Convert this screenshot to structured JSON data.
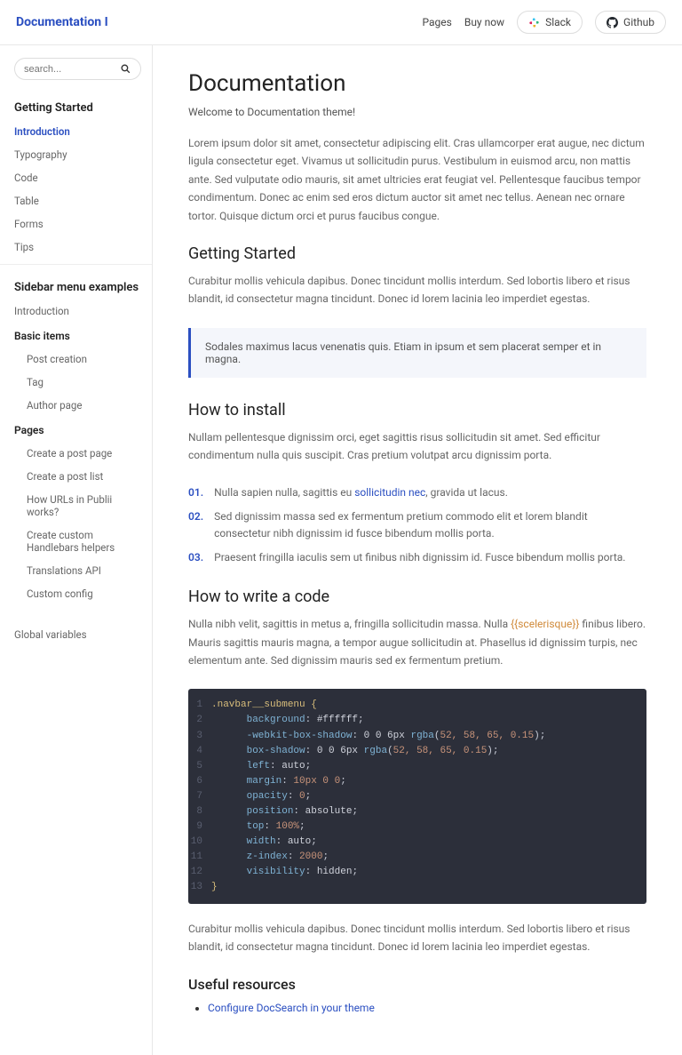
{
  "header": {
    "logo": "Documentation I",
    "pages": "Pages",
    "buynow": "Buy now",
    "slack": "Slack",
    "github": "Github"
  },
  "search": {
    "placeholder": "search..."
  },
  "sidebar": {
    "getting_started_title": "Getting Started",
    "items1": [
      "Introduction",
      "Typography",
      "Code",
      "Table",
      "Forms",
      "Tips"
    ],
    "examples_title": "Sidebar menu examples",
    "items2": [
      "Introduction"
    ],
    "basic_title": "Basic items",
    "basic_items": [
      "Post creation",
      "Tag",
      "Author page"
    ],
    "pages_title": "Pages",
    "pages_items": [
      "Create a post page",
      "Create a post list",
      "How URLs in Publii works?",
      "Create custom Handlebars helpers",
      "Translations API",
      "Custom config"
    ],
    "global": "Global variables"
  },
  "main": {
    "title": "Documentation",
    "welcome": "Welcome to Documentation theme!",
    "intro": "Lorem ipsum dolor sit amet, consectetur adipiscing elit. Cras ullamcorper erat augue, nec dictum ligula consectetur eget. Vivamus ut sollicitudin purus. Vestibulum in euismod arcu, non mattis ante. Sed vulputate odio mauris, sit amet ultricies erat feugiat vel. Pellentesque faucibus tempor condimentum. Donec ac enim sed eros dictum auctor sit amet nec tellus. Aenean nec ornare tortor. Quisque dictum orci et purus faucibus congue.",
    "gs_title": "Getting Started",
    "gs_text": "Curabitur mollis vehicula dapibus. Donec tincidunt mollis interdum. Sed lobortis libero et risus blandit, id consectetur magna tincidunt. Donec id lorem lacinia leo imperdiet egestas.",
    "callout": "Sodales maximus lacus venenatis quis. Etiam in ipsum et sem placerat semper et in magna.",
    "install_title": "How to install",
    "install_text": "Nullam pellentesque dignissim orci, eget sagittis risus sollicitudin sit amet. Sed efficitur condimentum nulla quis suscipit. Cras pretium volutpat arcu dignissim porta.",
    "ol1_a": "Nulla sapien nulla, sagittis eu ",
    "ol1_link": "sollicitudin nec",
    "ol1_b": ", gravida ut lacus.",
    "ol2": "Sed dignissim massa sed ex fermentum pretium commodo elit et lorem blandit consectetur nibh dignissim id fusce bibendum mollis porta.",
    "ol3": "Praesent fringilla iaculis sem ut finibus nibh dignissim id. Fusce bibendum mollis porta.",
    "code_title": "How to write a code",
    "code_text_a": "Nulla nibh velit, sagittis in metus a, fringilla sollicitudin massa. Nulla ",
    "code_token": "{{scelerisque}}",
    "code_text_b": " finibus libero. Mauris sagittis mauris magna, a tempor augue sollicitudin at. Phasellus id dignissim turpis, nec elementum ante. Sed dignissim mauris sed ex fermentum pretium.",
    "after_code": "Curabitur mollis vehicula dapibus. Donec tincidunt mollis interdum. Sed lobortis libero et risus blandit, id consectetur magna tincidunt. Donec id lorem lacinia leo imperdiet egestas.",
    "useful_title": "Useful resources",
    "useful_link": "Configure DocSearch in your theme"
  },
  "code": {
    "l1": ".navbar__submenu {",
    "l2_p": "background",
    "l2_v": "#ffffff",
    "l3_p": "-webkit-box-shadow",
    "l3_v1": "0 0 6px",
    "l3_f": "rgba",
    "l3_args": "52, 58, 65, 0.15",
    "l4_p": "box-shadow",
    "l5_p": "left",
    "l5_v": "auto",
    "l6_p": "margin",
    "l6_v": "10px 0 0",
    "l7_p": "opacity",
    "l7_v": "0",
    "l8_p": "position",
    "l8_v": "absolute",
    "l9_p": "top",
    "l9_v": "100%",
    "l10_p": "width",
    "l10_v": "auto",
    "l11_p": "z-index",
    "l11_v": "2000",
    "l12_p": "visibility",
    "l12_v": "hidden",
    "l13": "}"
  }
}
